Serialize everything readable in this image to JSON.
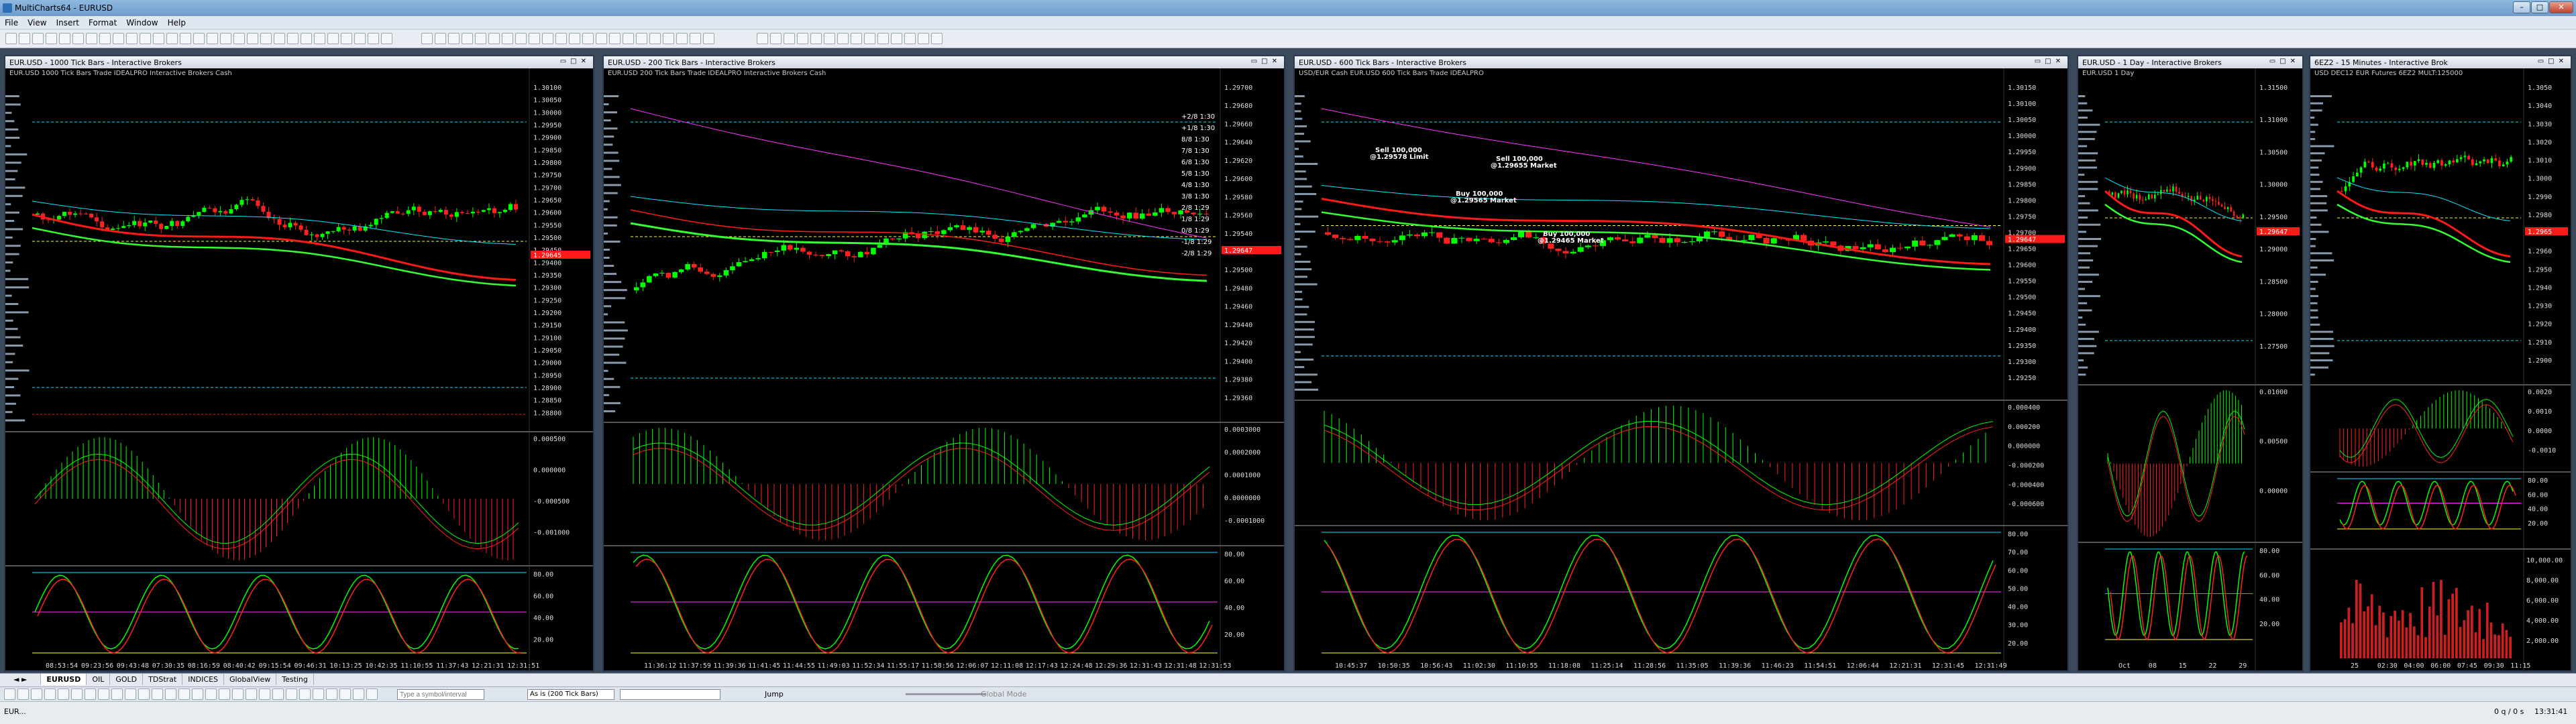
{
  "app": {
    "title": "MultiCharts64 - EURUSD"
  },
  "window_controls": {
    "min": "–",
    "max": "□",
    "close": "✕"
  },
  "menu": [
    "File",
    "View",
    "Insert",
    "Format",
    "Window",
    "Help"
  ],
  "charts": [
    {
      "id": "c1",
      "title": "EUR.USD - 1000 Tick Bars - Interactive Brokers",
      "sub": "EUR.USD  1000 Tick Bars   Trade  IDEALPRO  Interactive Brokers  Cash",
      "price_axis": [
        "1.30100",
        "1.30050",
        "1.30000",
        "1.29950",
        "1.29900",
        "1.29850",
        "1.29800",
        "1.29750",
        "1.29700",
        "1.29650",
        "1.29600",
        "1.29550",
        "1.29500",
        "1.29450",
        "1.29400",
        "1.29350",
        "1.29300",
        "1.29250",
        "1.29200",
        "1.29150",
        "1.29100",
        "1.29050",
        "1.29000",
        "1.28950",
        "1.28900",
        "1.28850",
        "1.28800"
      ],
      "tag": "1.29645",
      "macd_axis": [
        "0.000500",
        "0.000000",
        "-0.000500",
        "-0.001000"
      ],
      "rsi_axis": [
        "80.00",
        "60.00",
        "40.00",
        "20.00"
      ],
      "time_axis": [
        "08:53:54",
        "09:23:56",
        "09:43:48",
        "07:30:35",
        "08:16:59",
        "08:40:42",
        "09:15:54",
        "09:46:31",
        "10:13:25",
        "10:42:35",
        "11:10:55",
        "11:37:43",
        "12:21:31",
        "12:31:51"
      ]
    },
    {
      "id": "c2",
      "title": "EUR.USD - 200 Tick Bars - Interactive Brokers",
      "sub": "EUR.USD  200 Tick Bars   Trade  IDEALPRO  Interactive Brokers  Cash",
      "price_axis": [
        "1.29700",
        "1.29680",
        "1.29660",
        "1.29640",
        "1.29620",
        "1.29600",
        "1.29580",
        "1.29560",
        "1.29540",
        "1.29520",
        "1.29500",
        "1.29480",
        "1.29460",
        "1.29440",
        "1.29420",
        "1.29400",
        "1.29380",
        "1.29360"
      ],
      "murrey": [
        "+2/8 1:30",
        "+1/8 1:30",
        "8/8 1:30",
        "7/8 1:30",
        "6/8 1:30",
        "5/8 1:30",
        "4/8 1:30",
        "3/8 1:30",
        "2/8 1:29",
        "1/8 1:29",
        "0/8 1:29",
        "-1/8 1:29",
        "-2/8 1:29"
      ],
      "tag": "1.29647",
      "macd_axis": [
        "0.0003000",
        "0.0002000",
        "0.0001000",
        "0.0000000",
        "-0.0001000"
      ],
      "rsi_axis": [
        "80.00",
        "60.00",
        "40.00",
        "20.00"
      ],
      "time_axis": [
        "11:36:12",
        "11:37:59",
        "11:39:36",
        "11:41:45",
        "11:44:55",
        "11:49:03",
        "11:52:34",
        "11:55:17",
        "11:58:56",
        "12:06:07",
        "12:11:08",
        "12:17:43",
        "12:24:48",
        "12:29:36",
        "12:31:43",
        "12:31:48",
        "12:31:53"
      ]
    },
    {
      "id": "c3",
      "title": "EUR.USD - 600 Tick Bars - Interactive Brokers",
      "sub": "USD/EUR Cash  EUR.USD  600 Tick Bars   Trade  IDEALPRO",
      "price_axis": [
        "1.30150",
        "1.30100",
        "1.30050",
        "1.30000",
        "1.29950",
        "1.29900",
        "1.29850",
        "1.29800",
        "1.29750",
        "1.29700",
        "1.29650",
        "1.29600",
        "1.29550",
        "1.29500",
        "1.29450",
        "1.29400",
        "1.29350",
        "1.29300",
        "1.29250"
      ],
      "trades": [
        {
          "label": "Sell 100,000",
          "sub": "@1.29578 Limit"
        },
        {
          "label": "Sell 100,000",
          "sub": "@1.29655 Market"
        },
        {
          "label": "Buy 100,000",
          "sub": "@1.29565 Market"
        },
        {
          "label": "Buy 100,000",
          "sub": "@1.29465 Market"
        }
      ],
      "tag": "1.29647",
      "macd_axis": [
        "0.000400",
        "0.000200",
        "0.000000",
        "-0.000200",
        "-0.000400",
        "-0.000600"
      ],
      "rsi_axis": [
        "80.00",
        "70.00",
        "60.00",
        "50.00",
        "40.00",
        "30.00",
        "20.00"
      ],
      "time_axis": [
        "10:45:37",
        "10:50:35",
        "10:56:43",
        "11:02:30",
        "11:10:55",
        "11:18:08",
        "11:25:14",
        "11:28:56",
        "11:35:05",
        "11:39:36",
        "11:46:23",
        "11:54:51",
        "12:06:44",
        "12:21:31",
        "12:31:45",
        "12:31:49"
      ]
    },
    {
      "id": "c4",
      "title": "EUR.USD - 1 Day - Interactive Brokers",
      "sub": "EUR.USD  1 Day",
      "price_axis": [
        "1.31500",
        "1.31000",
        "1.30500",
        "1.30000",
        "1.29500",
        "1.29000",
        "1.28500",
        "1.28000",
        "1.27500"
      ],
      "tag": "1.29647",
      "macd_axis": [
        "0.01000",
        "0.00500",
        "0.00000"
      ],
      "rsi_axis": [
        "80.00",
        "60.00",
        "40.00",
        "20.00"
      ],
      "time_axis": [
        "Oct",
        "08",
        "15",
        "22",
        "29"
      ]
    },
    {
      "id": "c5",
      "title": "6EZ2 - 15 Minutes - Interactive Brok",
      "sub": "USD  DEC12  EUR Futures  6EZ2  MULT:125000",
      "price_axis": [
        "1.3050",
        "1.3040",
        "1.3030",
        "1.3020",
        "1.3010",
        "1.3000",
        "1.2990",
        "1.2980",
        "1.2970",
        "1.2960",
        "1.2950",
        "1.2940",
        "1.2930",
        "1.2920",
        "1.2910",
        "1.2900"
      ],
      "tag": "1.2965",
      "macd_axis": [
        "0.0020",
        "0.0010",
        "0.0000",
        "-0.0010"
      ],
      "rsi_axis": [
        "80.00",
        "60.00",
        "40.00",
        "20.00"
      ],
      "vol_axis": [
        "10,000.00",
        "8,000.00",
        "6,000.00",
        "4,000.00",
        "2,000.00"
      ],
      "time_axis": [
        "25",
        "02:30",
        "04:00",
        "06:00",
        "07:45",
        "09:30",
        "11:15"
      ]
    }
  ],
  "tabs": [
    "EURUSD",
    "OIL",
    "GOLD",
    "TDStrat",
    "INDICES",
    "GlobalView",
    "Testing"
  ],
  "bottom": {
    "symbol_placeholder": "Type a symbol/interval",
    "resolution": "As is (200 Tick Bars)",
    "jump": "Jump",
    "global_mode": "Global Mode"
  },
  "status": {
    "left": "EUR...",
    "right_counts": "0 q / 0 s",
    "time": "13:31:41"
  },
  "colors": {
    "bull": "#00ff00",
    "bear": "#ff2020",
    "ma_red": "#ff1a1a",
    "ma_green": "#33ff33",
    "cyan": "#00e5ff",
    "magenta": "#ff33ff",
    "yellow": "#ffff33",
    "bg": "#000000"
  }
}
